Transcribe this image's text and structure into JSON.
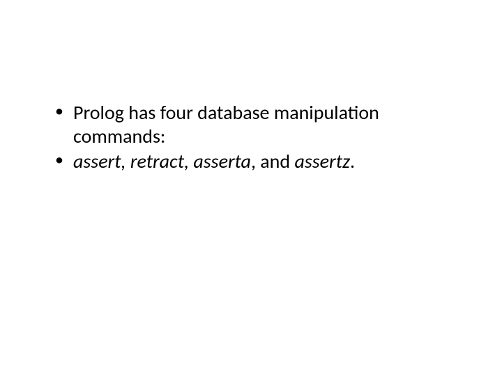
{
  "slide": {
    "bullets": [
      {
        "text": "Prolog has four database manipulation commands:"
      },
      {
        "parts": {
          "italic1": "assert, retract, asserta",
          "plain1": ", and ",
          "italic2": "assertz",
          "plain2": "."
        }
      }
    ]
  }
}
